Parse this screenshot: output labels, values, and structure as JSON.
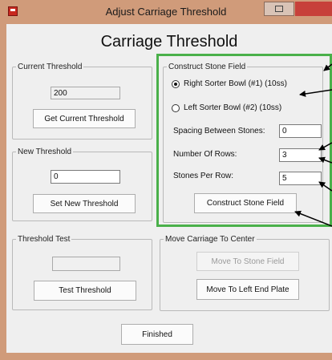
{
  "window": {
    "title": "Adjust Carriage Threshold",
    "heading": "Carriage Threshold"
  },
  "current_threshold": {
    "legend": "Current Threshold",
    "value": "200",
    "button": "Get Current Threshold"
  },
  "new_threshold": {
    "legend": "New Threshold",
    "value": "0",
    "button": "Set New Threshold"
  },
  "threshold_test": {
    "legend": "Threshold Test",
    "value": "",
    "button": "Test Threshold"
  },
  "construct_stone_field": {
    "legend": "Construct Stone Field",
    "radio_right": "Right Sorter Bowl (#1) (10ss)",
    "radio_left": "Left Sorter Bowl (#2) (10ss)",
    "spacing_label": "Spacing Between Stones:",
    "spacing_value": "0",
    "rows_label": "Number Of Rows:",
    "rows_value": "3",
    "per_row_label": "Stones Per Row:",
    "per_row_value": "5",
    "button": "Construct Stone Field"
  },
  "move_carriage": {
    "legend": "Move Carriage To Center",
    "button_stone_field": "Move To Stone Field",
    "button_left_plate": "Move To Left End Plate"
  },
  "footer": {
    "finished": "Finished"
  },
  "colors": {
    "highlight": "#4ab04a",
    "frame": "#d09b7a",
    "close": "#c7403a"
  }
}
